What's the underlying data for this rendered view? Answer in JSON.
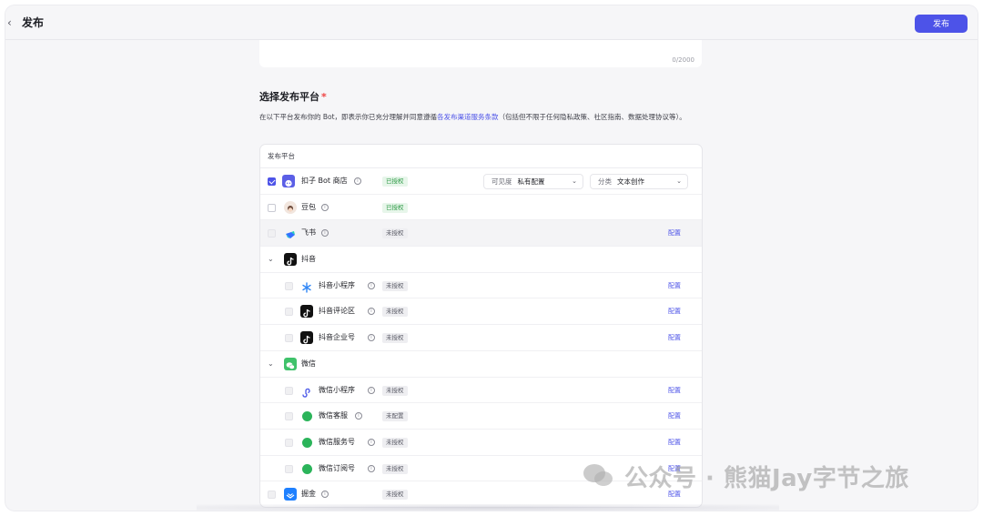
{
  "header": {
    "back_icon": "chevron-left-icon",
    "title": "发布",
    "publish_label": "发布"
  },
  "textbox": {
    "counter": "0/2000"
  },
  "section": {
    "title": "选择发布平台",
    "required_mark": "*",
    "desc_prefix": "在以下平台发布你的 Bot，即表示你已充分理解并同意遵循",
    "desc_link": "各发布渠道服务条款",
    "desc_suffix": "（包括但不限于任何隐私政策、社区指南、数据处理协议等）。"
  },
  "table": {
    "header": "发布平台",
    "visibility_label": "可见度",
    "visibility_value": "私有配置",
    "category_label": "分类",
    "category_value": "文本创作",
    "info_glyph": "i",
    "config_label": "配置",
    "rows": [
      {
        "name": "扣子 Bot 商店",
        "badge": "已授权",
        "status": "ok",
        "checked": true,
        "icon": "coze-icon"
      },
      {
        "name": "豆包",
        "badge": "已授权",
        "status": "ok",
        "icon": "doubao-icon"
      },
      {
        "name": "飞书",
        "badge": "未授权",
        "status": "no",
        "icon": "feishu-icon"
      },
      {
        "name": "抖音",
        "group": true,
        "icon": "douyin-icon"
      },
      {
        "name": "抖音小程序",
        "badge": "未授权",
        "status": "no",
        "icon": "douyin-miniapp-icon"
      },
      {
        "name": "抖音评论区",
        "badge": "未授权",
        "status": "no",
        "icon": "douyin-icon"
      },
      {
        "name": "抖音企业号",
        "badge": "未授权",
        "status": "no",
        "icon": "douyin-icon"
      },
      {
        "name": "微信",
        "group": true,
        "icon": "wechat-icon"
      },
      {
        "name": "微信小程序",
        "badge": "未授权",
        "status": "no",
        "icon": "wechat-miniapp-icon"
      },
      {
        "name": "微信客服",
        "badge": "未配置",
        "status": "no",
        "icon": "wechat-service-icon"
      },
      {
        "name": "微信服务号",
        "badge": "未授权",
        "status": "no",
        "icon": "wechat-service-icon"
      },
      {
        "name": "微信订阅号",
        "badge": "未授权",
        "status": "no",
        "icon": "wechat-service-icon"
      },
      {
        "name": "掘金",
        "badge": "未授权",
        "status": "no",
        "icon": "juejin-icon"
      }
    ]
  },
  "watermark": {
    "text": "公众号 · 熊猫Jay字节之旅"
  },
  "colors": {
    "accent": "#4d53e8",
    "authorized": "#2f9a47"
  }
}
